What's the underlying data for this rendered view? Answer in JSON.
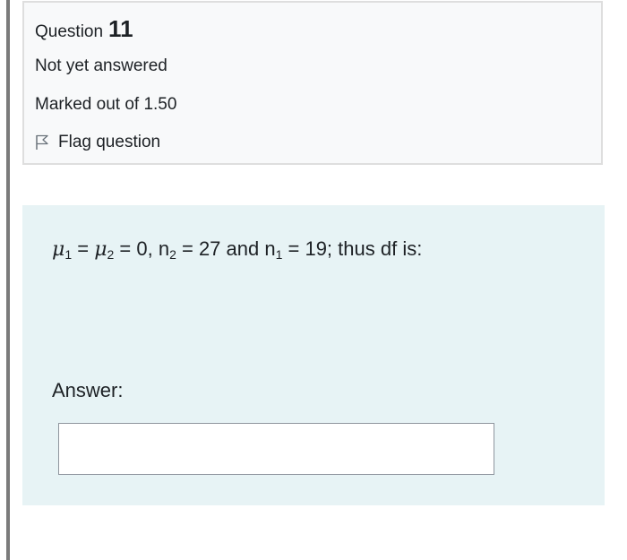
{
  "question_info": {
    "label": "Question",
    "number": "11",
    "state": "Not yet answered",
    "grade": "Marked out of 1.50",
    "flag_label": "Flag question"
  },
  "question": {
    "mu1": "μ",
    "sub1": "1",
    "eq1": " = ",
    "mu2": "μ",
    "sub2": "2",
    "part1": " = 0, n",
    "sub_n2": "2",
    "part2": " = 27 and n",
    "sub_n1": "1",
    "part3": " = 19; thus df is:",
    "answer_label": "Answer:",
    "answer_value": ""
  },
  "icons": {
    "flag": "flag-outline-icon"
  },
  "colors": {
    "info_background": "#f8f9fa",
    "info_border": "#dedede",
    "content_background": "#e7f3f5",
    "input_border": "#8f959e",
    "left_rule": "#7b7b7b"
  }
}
